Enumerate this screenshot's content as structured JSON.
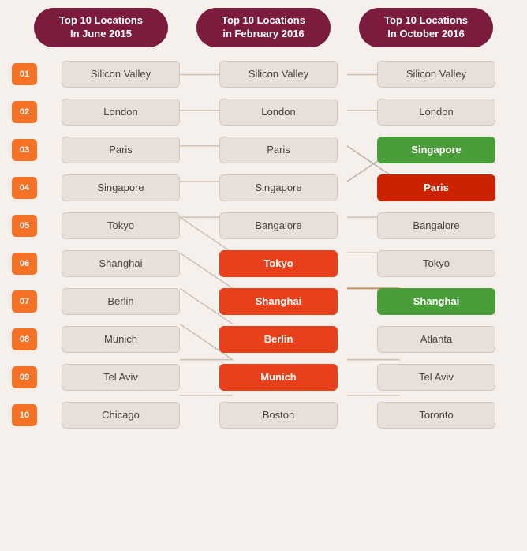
{
  "headers": [
    {
      "label": "Top 10 Locations\nIn June 2015",
      "id": "header-june-2015"
    },
    {
      "label": "Top 10 Locations\nin February 2016",
      "id": "header-feb-2016"
    },
    {
      "label": "Top 10 Locations\nIn October 2016",
      "id": "header-oct-2016"
    }
  ],
  "rows": [
    {
      "rank": "01",
      "cols": [
        {
          "text": "Silicon Valley",
          "style": "default"
        },
        {
          "text": "Silicon Valley",
          "style": "default"
        },
        {
          "text": "Silicon Valley",
          "style": "default"
        }
      ]
    },
    {
      "rank": "02",
      "cols": [
        {
          "text": "London",
          "style": "default"
        },
        {
          "text": "London",
          "style": "default"
        },
        {
          "text": "London",
          "style": "default"
        }
      ]
    },
    {
      "rank": "03",
      "cols": [
        {
          "text": "Paris",
          "style": "default"
        },
        {
          "text": "Paris",
          "style": "default"
        },
        {
          "text": "Singapore",
          "style": "green"
        }
      ]
    },
    {
      "rank": "04",
      "cols": [
        {
          "text": "Singapore",
          "style": "default"
        },
        {
          "text": "Singapore",
          "style": "default"
        },
        {
          "text": "Paris",
          "style": "red"
        }
      ]
    },
    {
      "rank": "05",
      "cols": [
        {
          "text": "Tokyo",
          "style": "default"
        },
        {
          "text": "Bangalore",
          "style": "default"
        },
        {
          "text": "Bangalore",
          "style": "default"
        }
      ]
    },
    {
      "rank": "06",
      "cols": [
        {
          "text": "Shanghai",
          "style": "default"
        },
        {
          "text": "Tokyo",
          "style": "orange"
        },
        {
          "text": "Tokyo",
          "style": "default"
        }
      ]
    },
    {
      "rank": "07",
      "cols": [
        {
          "text": "Berlin",
          "style": "default"
        },
        {
          "text": "Shanghai",
          "style": "orange"
        },
        {
          "text": "Shanghai",
          "style": "green"
        }
      ]
    },
    {
      "rank": "08",
      "cols": [
        {
          "text": "Munich",
          "style": "default"
        },
        {
          "text": "Berlin",
          "style": "orange"
        },
        {
          "text": "Atlanta",
          "style": "default"
        }
      ]
    },
    {
      "rank": "09",
      "cols": [
        {
          "text": "Tel Aviv",
          "style": "default"
        },
        {
          "text": "Munich",
          "style": "orange"
        },
        {
          "text": "Tel Aviv",
          "style": "default"
        }
      ]
    },
    {
      "rank": "10",
      "cols": [
        {
          "text": "Chicago",
          "style": "default"
        },
        {
          "text": "Boston",
          "style": "default"
        },
        {
          "text": "Toronto",
          "style": "default"
        }
      ]
    }
  ],
  "colors": {
    "header_bg": "#7b1c3e",
    "rank_bg": "#f47225",
    "orange": "#e8401a",
    "green": "#4a9e3a",
    "red": "#cc2200",
    "default_box": "#e8e0d8"
  }
}
